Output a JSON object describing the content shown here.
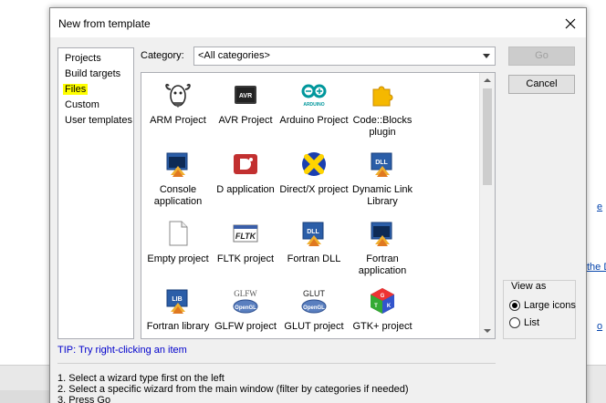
{
  "dialog": {
    "title": "New from template"
  },
  "categories": {
    "items": [
      {
        "label": "Projects",
        "selected": false
      },
      {
        "label": "Build targets",
        "selected": false
      },
      {
        "label": "Files",
        "selected": true
      },
      {
        "label": "Custom",
        "selected": false
      },
      {
        "label": "User templates",
        "selected": false
      }
    ]
  },
  "category_filter": {
    "label": "Category:",
    "value": "<All categories>"
  },
  "templates": [
    {
      "label": "ARM Project",
      "icon": "gnu-icon"
    },
    {
      "label": "AVR Project",
      "icon": "avr-chip-icon"
    },
    {
      "label": "Arduino Project",
      "icon": "arduino-icon"
    },
    {
      "label": "Code::Blocks plugin",
      "icon": "puzzle-plugin-icon"
    },
    {
      "label": "Console application",
      "icon": "console-icon"
    },
    {
      "label": "D application",
      "icon": "d-lang-icon"
    },
    {
      "label": "Direct/X project",
      "icon": "directx-icon"
    },
    {
      "label": "Dynamic Link Library",
      "icon": "dll-icon"
    },
    {
      "label": "Empty project",
      "icon": "blank-page-icon"
    },
    {
      "label": "FLTK project",
      "icon": "fltk-icon"
    },
    {
      "label": "Fortran DLL",
      "icon": "fortran-dll-icon"
    },
    {
      "label": "Fortran application",
      "icon": "fortran-app-icon"
    },
    {
      "label": "Fortran library",
      "icon": "lib-icon"
    },
    {
      "label": "GLFW project",
      "icon": "glfw-icon"
    },
    {
      "label": "GLUT project",
      "icon": "glut-icon"
    },
    {
      "label": "GTK+ project",
      "icon": "gtk-icon"
    }
  ],
  "buttons": {
    "go": "Go",
    "cancel": "Cancel"
  },
  "view_as": {
    "title": "View as",
    "large": "Large icons",
    "list": "List",
    "selected": "large"
  },
  "tip": "TIP: Try right-clicking an item",
  "instructions": [
    "1. Select a wizard type first on the left",
    "2. Select a specific wizard from the main window (filter by categories if needed)",
    "3. Press Go"
  ],
  "icon_text": {
    "avr": "AVR",
    "arduino": "ARDUINO",
    "dll": "DLL",
    "fltk": "FLTK",
    "lib": "LIB",
    "glfw": "GLFW",
    "glut": "GLUT",
    "opengl": "OpenGL",
    "gtk_g": "G",
    "gtk_t": "T",
    "gtk_k": "K"
  },
  "background": {
    "link_fragment_1": "e",
    "link_fragment_2": "the D",
    "link_fragment_3": "o"
  },
  "colors": {
    "selection_highlight": "#ffff00",
    "tip_text": "#0000cc",
    "link": "#0645ad"
  }
}
